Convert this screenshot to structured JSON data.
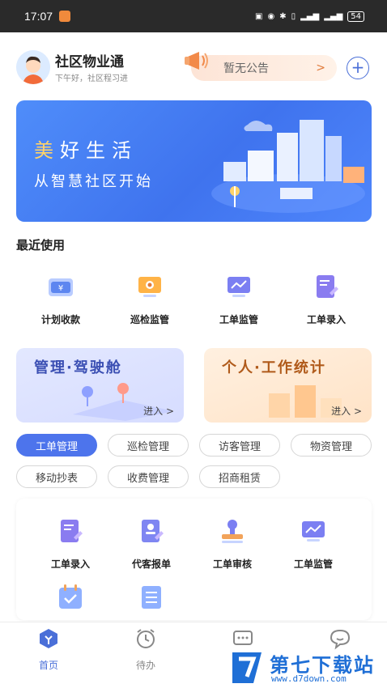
{
  "status_bar": {
    "time": "17:07",
    "battery": "54"
  },
  "header": {
    "app_title": "社区物业通",
    "greeting": "下午好，社区程习进",
    "notice_text": "暂无公告",
    "notice_arrow": ">",
    "add_icon": "plus-circle-icon"
  },
  "banner": {
    "title": "美好生活",
    "subtitle": "从智慧社区开始"
  },
  "recent": {
    "title": "最近使用",
    "items": [
      {
        "label": "计划收款",
        "icon": "payment-plan-icon"
      },
      {
        "label": "巡检监管",
        "icon": "inspection-monitor-icon"
      },
      {
        "label": "工单监管",
        "icon": "workorder-monitor-icon"
      },
      {
        "label": "工单录入",
        "icon": "workorder-entry-icon"
      }
    ]
  },
  "cards": [
    {
      "title": "管理·驾驶舱",
      "enter": "进入 >"
    },
    {
      "title": "个人·工作统计",
      "enter": "进入 >"
    }
  ],
  "chips": [
    "工单管理",
    "巡检管理",
    "访客管理",
    "物资管理",
    "移动抄表",
    "收费管理",
    "招商租赁"
  ],
  "active_chip": "工单管理",
  "functions": [
    {
      "label": "工单录入",
      "icon": "workorder-entry-icon"
    },
    {
      "label": "代客报单",
      "icon": "proxy-report-icon"
    },
    {
      "label": "工单审核",
      "icon": "workorder-review-icon"
    },
    {
      "label": "工单监管",
      "icon": "workorder-monitor-icon"
    },
    {
      "label": "",
      "icon": "calendar-check-icon"
    },
    {
      "label": "",
      "icon": "list-icon"
    }
  ],
  "bottom_nav": [
    {
      "label": "首页",
      "icon": "home-icon",
      "active": true
    },
    {
      "label": "待办",
      "icon": "clock-icon",
      "active": false
    },
    {
      "label": "",
      "icon": "message-icon",
      "active": false
    },
    {
      "label": "",
      "icon": "chat-icon",
      "active": false
    }
  ],
  "watermark": {
    "text": "第七下载站",
    "url": "www.d7down.com"
  },
  "colors": {
    "primary": "#4d74ec",
    "orange": "#e07a3a",
    "banner": "#4f86fb"
  }
}
